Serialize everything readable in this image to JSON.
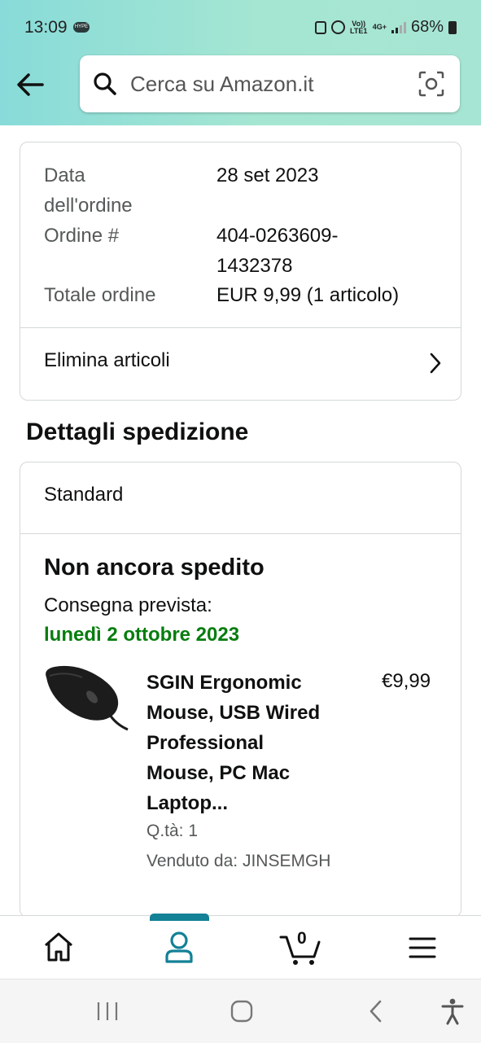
{
  "status_bar": {
    "time": "13:09",
    "badge": "HYPE",
    "net_top": "Vo)) LTE1",
    "net_mid": "4G+",
    "battery": "68%"
  },
  "search": {
    "placeholder": "Cerca su Amazon.it"
  },
  "order": {
    "date_label_1": "Data",
    "date_label_2": "dell'ordine",
    "date_value": "28 set 2023",
    "number_label": "Ordine #",
    "number_value_1": "404-0263609-",
    "number_value_2": "1432378",
    "total_label": "Totale ordine",
    "total_value": "EUR 9,99 (1 articolo)",
    "delete_items": "Elimina articoli"
  },
  "shipping": {
    "title": "Dettagli spedizione",
    "method": "Standard",
    "status": "Non ancora spedito",
    "delivery_label": "Consegna prevista:",
    "delivery_date": "lunedì 2 ottobre 2023",
    "item": {
      "title_lines": [
        "SGIN Ergonomic",
        "Mouse, USB Wired",
        "Professional",
        "Mouse, PC Mac",
        "Laptop..."
      ],
      "price": "€9,99",
      "qty": "Q.tà: 1",
      "seller": "Venduto da: JINSEMGH"
    }
  },
  "bottom_nav": {
    "cart_count": "0"
  },
  "colors": {
    "accent": "#138196",
    "delivery_green": "#067d0e",
    "header_gradient": "#88dbd9"
  },
  "icons": [
    "back-arrow-icon",
    "search-icon",
    "camera-scan-icon",
    "chevron-right-icon",
    "home-icon",
    "account-icon",
    "cart-icon",
    "menu-icon",
    "recents-icon",
    "home-circle-icon",
    "back-chevron-icon",
    "accessibility-icon"
  ]
}
